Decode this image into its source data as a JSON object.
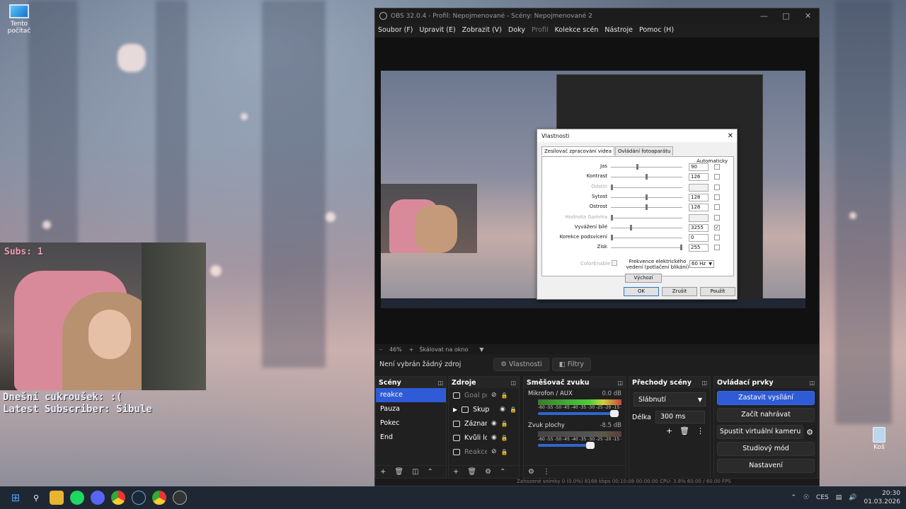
{
  "desktop": {
    "icon_label": "Tento počítač",
    "recycle_label": "Koš"
  },
  "cam_overlay": {
    "subs_label": "Subs: 1",
    "line1": "Dnešní cukroušek: :(",
    "line2": "Latest Subscriber: Sibule",
    "subs_color": "#f29ab2"
  },
  "obs": {
    "title": "OBS 32.0.4 - Profil: Nepojmenované - Scény: Nepojmenované 2",
    "menu": [
      "Soubor (F)",
      "Upravit (E)",
      "Zobrazit (V)",
      "Doky",
      "Profil",
      "Kolekce scén",
      "Nástroje",
      "Pomoc (H)"
    ],
    "zoom": "46%",
    "zoom_mode": "Škálovat na okno",
    "no_source": "Není vybrán žádný zdroj",
    "btn_props": "Vlastnosti",
    "btn_filters": "Filtry",
    "docks": {
      "scenes": {
        "title": "Scény",
        "items": [
          "reakce",
          "Pauza",
          "Pokec",
          "End"
        ]
      },
      "sources": {
        "title": "Zdroje",
        "items": [
          "Goal prc",
          "Skup",
          "Záznam",
          "Kvůli lol",
          "Reakce"
        ]
      },
      "mixer": {
        "title": "Směšovač zvuku",
        "channels": [
          {
            "name": "Mikrofon / AUX",
            "db": "0.0 dB"
          },
          {
            "name": "Zvuk plochy",
            "db": "-8.5 dB"
          }
        ],
        "scale": "-60 -55 -50 -45 -40 -35 -30 -25 -20 -15 -10 -5 0"
      },
      "transitions": {
        "title": "Přechody scény",
        "selected": "Slábnutí",
        "duration_label": "Délka",
        "duration_value": "300 ms"
      },
      "controls": {
        "title": "Ovládací prvky",
        "buttons": [
          "Zastavit vysílání",
          "Začít nahrávat",
          "Spustit virtuální kameru",
          "Studiový mód",
          "Nastavení"
        ]
      }
    },
    "status": "Zahozené snímky 0 (0.0%)   8168 kbps   00:10:08   00:00:00   CPU: 3.8%   60.00 / 60.00 FPS"
  },
  "dialog": {
    "title": "Vlastnosti",
    "tabs": [
      "Zesilovač zpracování videa",
      "Ovládání fotoaparátu"
    ],
    "auto_label": "Automaticky",
    "rows": [
      {
        "label": "Jas",
        "value": "90",
        "level": 0.37,
        "enabled": true,
        "auto": false
      },
      {
        "label": "Kontrast",
        "value": "126",
        "level": 0.5,
        "enabled": true,
        "auto": false
      },
      {
        "label": "Odstín",
        "value": "",
        "level": 0.0,
        "enabled": false,
        "auto": false
      },
      {
        "label": "Sytost",
        "value": "128",
        "level": 0.5,
        "enabled": true,
        "auto": false
      },
      {
        "label": "Ostrost",
        "value": "128",
        "level": 0.5,
        "enabled": true,
        "auto": false
      },
      {
        "label": "Hodnota Gamma",
        "value": "",
        "level": 0.0,
        "enabled": false,
        "auto": false
      },
      {
        "label": "Vyvážení bílé",
        "value": "3255",
        "level": 0.28,
        "enabled": true,
        "auto": true
      },
      {
        "label": "Korekce podsvícení",
        "value": "0",
        "level": 0.0,
        "enabled": true,
        "auto": false
      },
      {
        "label": "Zisk",
        "value": "255",
        "level": 1.0,
        "enabled": true,
        "auto": false
      }
    ],
    "color_enable": "ColorEnable",
    "freq_label": "Frekvence elektrického vedení (potlačení blikání)",
    "freq_value": "60 Hz",
    "default_btn": "Výchozí",
    "ok": "OK",
    "cancel": "Zrušit",
    "apply": "Použít"
  },
  "taskbar": {
    "lang": "CES",
    "time": "20:30",
    "date": "01.03.2026",
    "icons": [
      "windows-icon",
      "search-icon",
      "file-explorer-icon",
      "spotify-icon",
      "discord-icon",
      "chrome-icon",
      "steam-icon",
      "chrome-alt-icon",
      "obs-icon"
    ]
  }
}
